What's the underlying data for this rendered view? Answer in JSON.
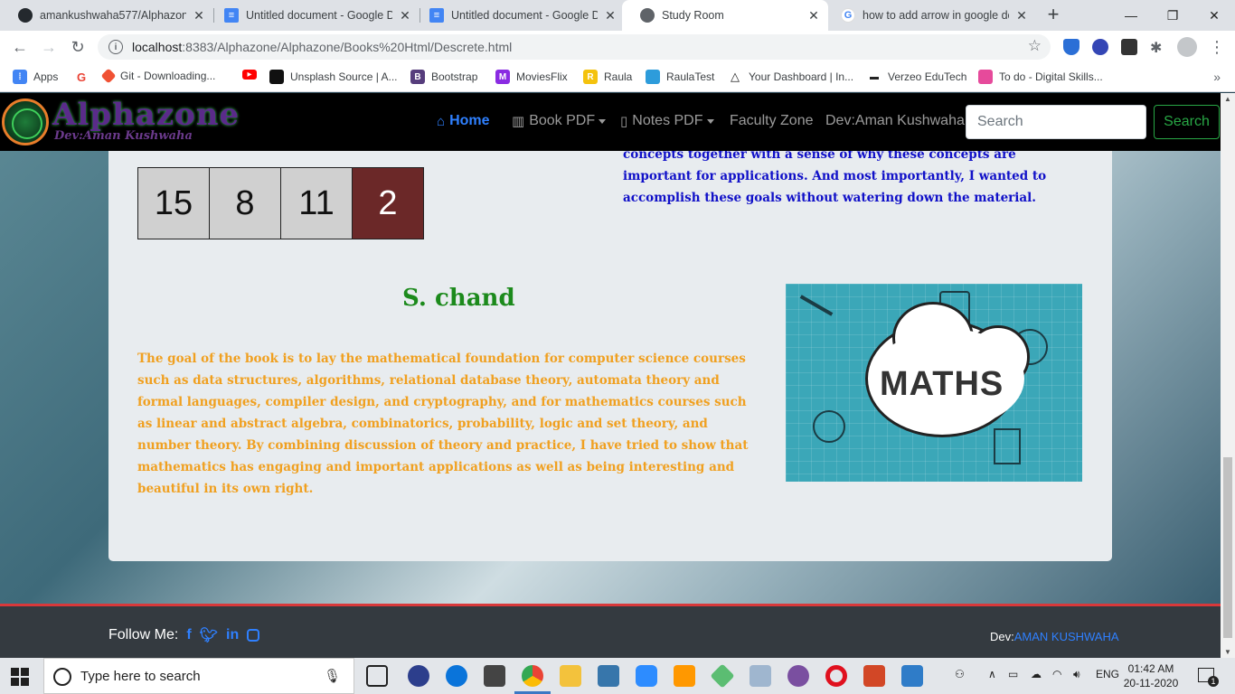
{
  "browser": {
    "tabs": [
      {
        "title": "amankushwaha577/Alphazone",
        "icon": "github-icon",
        "color": "#24292e"
      },
      {
        "title": "Untitled document - Google D",
        "icon": "google-docs-icon",
        "color": "#4285f4"
      },
      {
        "title": "Untitled document - Google D",
        "icon": "google-docs-icon",
        "color": "#4285f4"
      },
      {
        "title": "Study Room",
        "icon": "globe-icon",
        "color": "#5f6368"
      },
      {
        "title": "how to add arrow in google do",
        "icon": "google-icon",
        "color": "#4285f4"
      }
    ],
    "active_tab": 3,
    "url_host": "localhost",
    "url_path": ":8383/Alphazone/Alphazone/Books%20Html/Descrete.html",
    "bookmarks": [
      {
        "label": "Apps",
        "icon": "apps-grid-icon",
        "color": "#4285f4"
      },
      {
        "label": "",
        "icon": "google-icon",
        "color": "#ea4335"
      },
      {
        "label": "Git - Downloading...",
        "icon": "git-icon",
        "color": "#f05133"
      },
      {
        "label": "",
        "icon": "youtube-icon",
        "color": "#ff0000"
      },
      {
        "label": "Unsplash Source | A...",
        "icon": "unsplash-icon",
        "color": "#111111"
      },
      {
        "label": "Bootstrap",
        "icon": "bootstrap-icon",
        "color": "#563d7c"
      },
      {
        "label": "MoviesFlix",
        "icon": "moviesflix-icon",
        "color": "#8a2be2"
      },
      {
        "label": "Raula",
        "icon": "raula-icon",
        "color": "#f4c20d"
      },
      {
        "label": "RaulaTest",
        "icon": "raulatest-icon",
        "color": "#2d9cdb"
      },
      {
        "label": "Your Dashboard | In...",
        "icon": "dashboard-icon",
        "color": "#222222"
      },
      {
        "label": "Verzeo EduTech",
        "icon": "verzeo-icon",
        "color": "#222222"
      },
      {
        "label": "To do - Digital Skills...",
        "icon": "todo-icon",
        "color": "#e64a9b"
      }
    ]
  },
  "site": {
    "brand": "Alphazone",
    "brand_sub": "Dev:Aman Kushwaha",
    "nav": {
      "home": "Home",
      "book_pdf": "Book PDF",
      "notes_pdf": "Notes PDF",
      "faculty": "Faculty Zone",
      "dev": "Dev:Aman Kushwaha"
    },
    "search_placeholder": "Search",
    "search_button": "Search"
  },
  "grid": {
    "top_row_dark": [
      false,
      false,
      true,
      false
    ],
    "bottom_row": [
      "15",
      "8",
      "11",
      "2"
    ],
    "bottom_row_dark": [
      false,
      false,
      false,
      true
    ]
  },
  "right_text": "concepts together with a sense of why these concepts are important for applications. And most importantly, I wanted to accomplish these goals without watering down the material.",
  "book": {
    "title": "S. chand",
    "description": "The goal of the book is to lay the mathematical foundation for computer science courses such as data structures, algorithms, relational database theory, automata theory and formal languages, compiler design, and cryptography, and for mathematics courses such as linear and abstract algebra, combinatorics, probability, logic and set theory, and number theory. By combining discussion of theory and practice, I have tried to show that mathematics has engaging and important applications as well as being interesting and beautiful in its own right.",
    "image_word": "MATHS"
  },
  "footer": {
    "follow": "Follow Me:",
    "dev_prefix": "Dev:",
    "dev_name": "AMAN KUSHWAHA"
  },
  "taskbar": {
    "search_placeholder": "Type here to search",
    "lang": "ENG",
    "time": "01:42 AM",
    "date": "20-11-2020",
    "notifications": "1"
  }
}
